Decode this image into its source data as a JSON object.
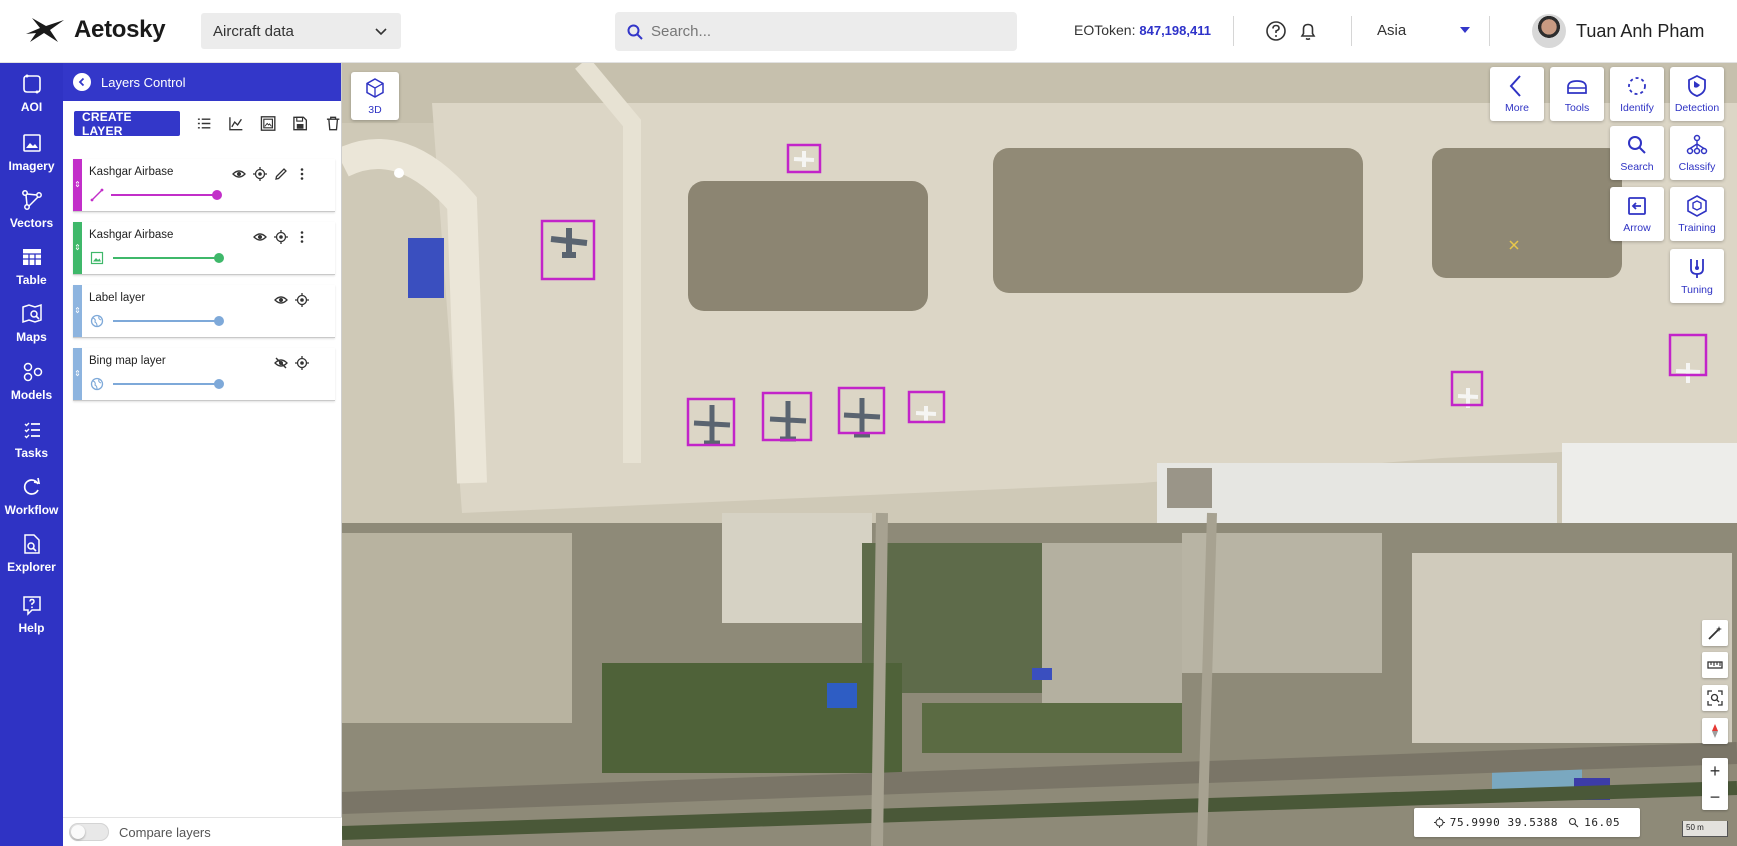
{
  "app": {
    "name": "Aetosky"
  },
  "header": {
    "dataset": "Aircraft data",
    "search_placeholder": "Search...",
    "token_label": "EOToken:",
    "token_value": "847,198,411",
    "region": "Asia",
    "user_name": "Tuan Anh Pham"
  },
  "rail": {
    "items": [
      {
        "label": "AOI",
        "icon": "aoi-icon"
      },
      {
        "label": "Imagery",
        "icon": "image-icon"
      },
      {
        "label": "Vectors",
        "icon": "vectors-icon"
      },
      {
        "label": "Table",
        "icon": "table-icon"
      },
      {
        "label": "Maps",
        "icon": "maps-icon"
      },
      {
        "label": "Models",
        "icon": "models-icon"
      },
      {
        "label": "Tasks",
        "icon": "tasks-icon"
      },
      {
        "label": "Workflow",
        "icon": "workflow-icon"
      },
      {
        "label": "Explorer",
        "icon": "explorer-icon"
      },
      {
        "label": "Help",
        "icon": "help-icon"
      }
    ]
  },
  "panel": {
    "title": "Layers Control",
    "create_label": "CREATE LAYER",
    "layers": [
      {
        "name": "Kashgar Airbase",
        "type": "vector",
        "color": "#c22fc9",
        "opacity": 0.99
      },
      {
        "name": "Kashgar Airbase",
        "type": "image",
        "color": "#3fb86a",
        "opacity": 0.99
      },
      {
        "name": "Label layer",
        "type": "basemap",
        "color": "#7ea9d9",
        "opacity": 0.99
      },
      {
        "name": "Bing map layer",
        "type": "basemap",
        "color": "#7ea9d9",
        "opacity": 0.99
      }
    ],
    "compare_label": "Compare layers"
  },
  "map": {
    "view_3d_label": "3D",
    "tools_top": [
      {
        "label": "More",
        "icon": "chevron-left-icon"
      },
      {
        "label": "Tools",
        "icon": "tools-icon"
      },
      {
        "label": "Identify",
        "icon": "identify-icon"
      },
      {
        "label": "Detection",
        "icon": "detection-icon"
      }
    ],
    "tools_row2": [
      {
        "label": "Search",
        "icon": "search-icon"
      },
      {
        "label": "Classify",
        "icon": "classify-icon"
      }
    ],
    "tools_row3": [
      {
        "label": "Arrow",
        "icon": "arrow-icon"
      },
      {
        "label": "Training",
        "icon": "training-icon"
      }
    ],
    "tools_row4": [
      {
        "label": "Tuning",
        "icon": "tuning-icon"
      }
    ],
    "coords": "75.9990 39.5388",
    "zoom": "16.05",
    "scale_label": "50 m",
    "zoom_in": "+",
    "zoom_out": "−",
    "detection_color": "#c224c9"
  }
}
